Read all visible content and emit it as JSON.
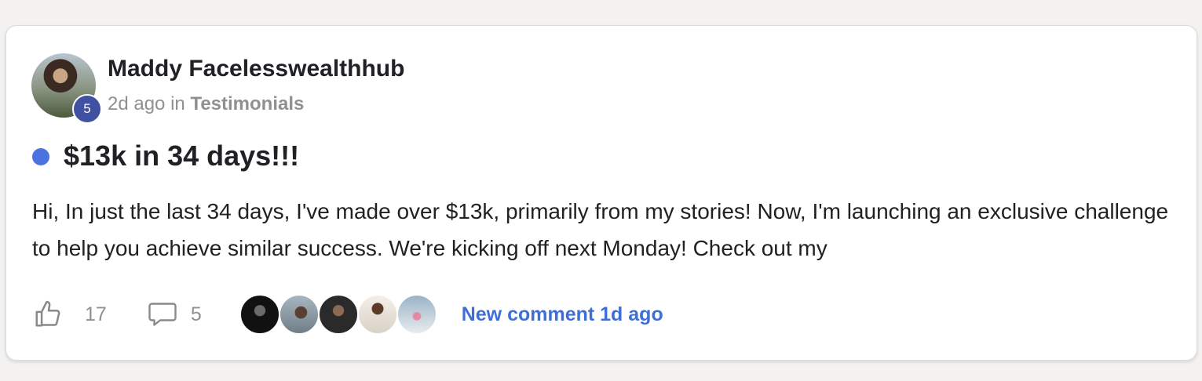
{
  "post": {
    "author": {
      "name": "Maddy Facelesswealthhub",
      "level": "5"
    },
    "meta": {
      "time": "2d ago",
      "in_text": "in",
      "category": "Testimonials"
    },
    "title": "$13k in 34 days!!!",
    "body": "Hi, In just the last 34 days, I've made over $13k, primarily from my stories! Now, I'm launching an exclusive challenge to help you achieve similar success. We're kicking off next Monday! Check out my",
    "likes": "17",
    "comments": "5",
    "new_comment_text": "New comment 1d ago"
  },
  "icons": {
    "like": "thumbs-up-icon",
    "comment": "comment-bubble-icon"
  },
  "colors": {
    "unread_dot": "#4a72e0",
    "level_badge": "#3f51a0",
    "link": "#3d6fd6",
    "muted": "#909090"
  }
}
